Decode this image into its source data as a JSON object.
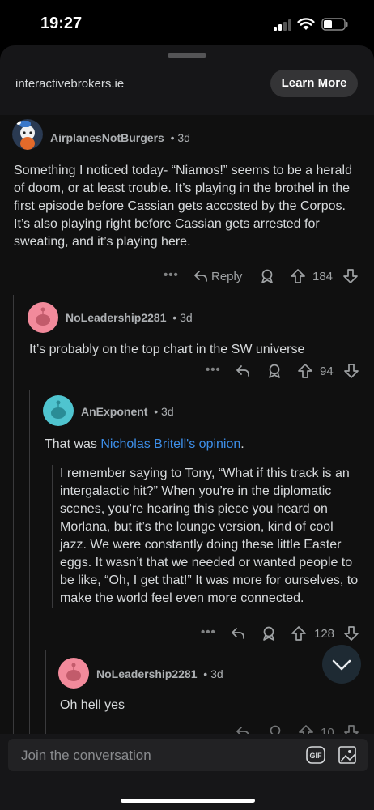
{
  "status_bar": {
    "time": "19:27"
  },
  "ad": {
    "domain": "interactivebrokers.ie",
    "cta": "Learn More"
  },
  "comments": [
    {
      "author": "AirplanesNotBurgers",
      "age": "3d",
      "text": "Something I noticed today- “Niamos!” seems to be a herald of doom, or at least trouble. It’s playing in the brothel in the first episode before Cassian gets accosted by the Corpos. It’s also playing right before Cassian gets arrested for sweating, and it’s playing here.",
      "reply_label": "Reply",
      "votes": "184",
      "avatar_color": "#2a3a52"
    },
    {
      "author": "NoLeadership2281",
      "age": "3d",
      "text": "It’s probably on the top chart in the SW universe",
      "votes": "94",
      "avatar_color": "#f28a9b"
    },
    {
      "author": "AnExponent",
      "age": "3d",
      "text_prefix": "That was ",
      "link_text": "Nicholas Britell's opinion",
      "text_suffix": ".",
      "quote": "I remember saying to Tony, “What if this track is an intergalactic hit?” When you’re in the diplomatic scenes, you’re hearing this piece you heard on Morlana, but it’s the lounge version, kind of cool jazz. We were constantly doing these little Easter eggs. It wasn’t that we needed or wanted people to be like, “Oh, I get that!” It was more for ourselves, to make the world feel even more connected.",
      "votes": "128",
      "avatar_color": "#4fc4cf"
    },
    {
      "author": "NoLeadership2281",
      "age": "3d",
      "text": "Oh hell yes",
      "votes": "10",
      "avatar_color": "#f28a9b"
    }
  ],
  "age_separator": "•",
  "more_glyph": "•••",
  "composer": {
    "placeholder": "Join the conversation",
    "gif_label": "GIF"
  },
  "icons": [
    "signal-icon",
    "wifi-icon",
    "battery-icon",
    "more-icon",
    "reply-icon",
    "award-icon",
    "upvote-icon",
    "downvote-icon",
    "chevron-down-icon",
    "gif-icon",
    "image-icon"
  ]
}
